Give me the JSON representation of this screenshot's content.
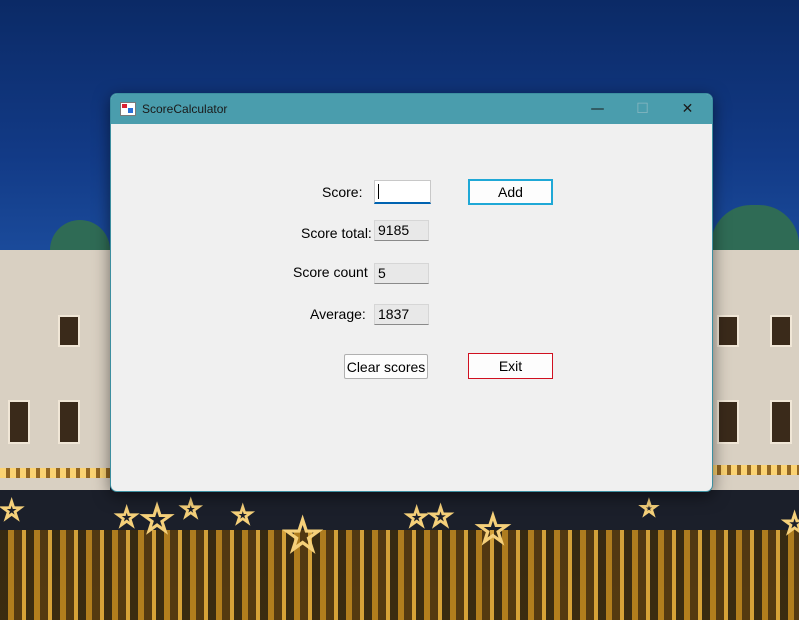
{
  "window": {
    "title": "ScoreCalculator",
    "controls": {
      "minimize": "—",
      "maximize": "☐",
      "close": "✕"
    }
  },
  "form": {
    "score_label": "Score:",
    "score_value": "",
    "score_total_label": "Score total:",
    "score_total_value": "9185",
    "score_count_label": "Score count",
    "score_count_value": "5",
    "average_label": "Average:",
    "average_value": "1837"
  },
  "buttons": {
    "add": "Add",
    "clear_scores": "Clear scores",
    "exit": "Exit"
  },
  "colors": {
    "titlebar": "#4a9dad",
    "add_button_border": "#1fa8d6",
    "exit_button_border": "#d01020",
    "input_focus": "#0063b1"
  },
  "wallpaper": {
    "star_glyph": "☆"
  }
}
